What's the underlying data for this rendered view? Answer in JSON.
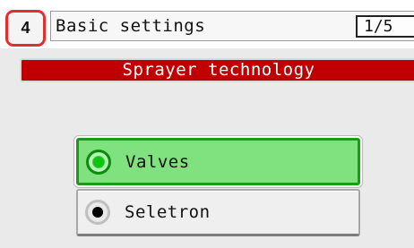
{
  "header": {
    "step_number": "4",
    "title": "Basic settings",
    "page_counter": "1/5"
  },
  "section": {
    "title": "Sprayer technology"
  },
  "options": [
    {
      "label": "Valves",
      "selected": true
    },
    {
      "label": "Seletron",
      "selected": false
    }
  ],
  "colors": {
    "step_border": "#e03030",
    "section_bar": "#c00000",
    "selected_fill": "#7fe27f",
    "selected_border": "#1d9a1d",
    "unselected_fill": "#efefef"
  }
}
